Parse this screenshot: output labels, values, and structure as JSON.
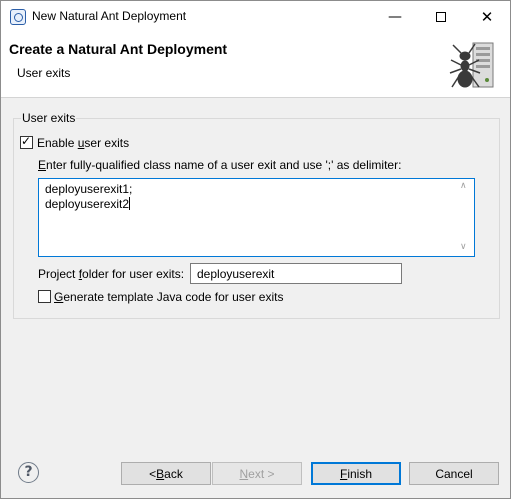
{
  "window": {
    "title": "New Natural Ant Deployment",
    "minimize_glyph": "—",
    "close_glyph": "✕"
  },
  "banner": {
    "title": "Create a Natural Ant Deployment",
    "subtitle": "User exits",
    "graphic_icon": "ant-server-icon"
  },
  "group": {
    "label": "User exits",
    "enable_checkbox": {
      "label_pre": "Enable ",
      "label_mnemonic": "u",
      "label_post": "ser exits",
      "checked": true
    },
    "classname_label": {
      "mnemonic": "E",
      "rest": "nter fully-qualified class name of a user exit and use ';' as delimiter:"
    },
    "classname_lines": [
      "deployuserexit1;",
      "deployuserexit2"
    ],
    "folder_label": {
      "pre": "Project ",
      "mnemonic": "f",
      "post": "older for user exits:"
    },
    "folder_value": "deployuserexit",
    "template_checkbox": {
      "mnemonic": "G",
      "label_rest": "enerate template Java code for user exits",
      "checked": false
    }
  },
  "footer": {
    "help_glyph": "?",
    "back": {
      "pre": "< ",
      "mnemonic": "B",
      "post": "ack"
    },
    "next": {
      "mnemonic": "N",
      "post": "ext >"
    },
    "finish": {
      "mnemonic": "F",
      "post": "inish"
    },
    "cancel": "Cancel"
  },
  "colors": {
    "accent": "#0078d7",
    "banner_bg": "#ffffff",
    "dialog_bg": "#f0f0f0"
  }
}
